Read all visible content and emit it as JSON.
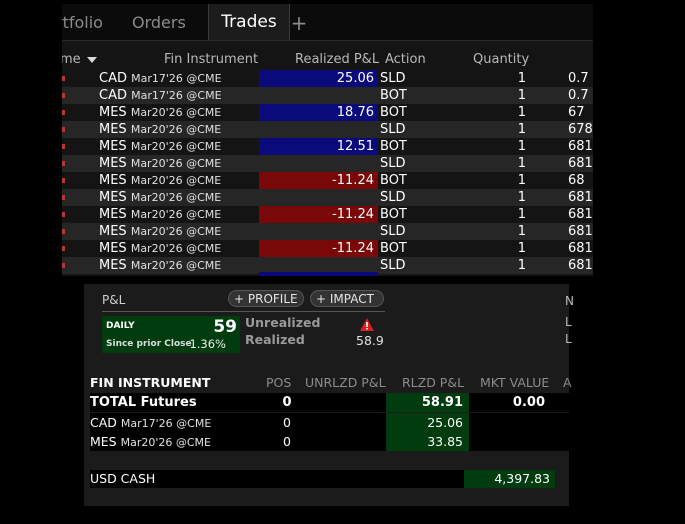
{
  "tabs": {
    "portfolio": "rtfolio",
    "orders": "Orders",
    "trades": "Trades",
    "add": "+"
  },
  "trades_table": {
    "headers": {
      "time": "me",
      "fin_instrument": "Fin Instrument",
      "realized_pnl": "Realized P&L",
      "action": "Action",
      "quantity": "Quantity"
    },
    "rows": [
      {
        "sym": "CAD",
        "exp": "Mar17'26 @CME",
        "rpl": "25.06",
        "sign": "pos",
        "action": "SLD",
        "qty": "1",
        "price": "0.7"
      },
      {
        "sym": "CAD",
        "exp": "Mar17'26 @CME",
        "rpl": "",
        "sign": "",
        "action": "BOT",
        "qty": "1",
        "price": "0.7"
      },
      {
        "sym": "MES",
        "exp": "Mar20'26 @CME",
        "rpl": "18.76",
        "sign": "pos",
        "action": "BOT",
        "qty": "1",
        "price": "67"
      },
      {
        "sym": "MES",
        "exp": "Mar20'26 @CME",
        "rpl": "",
        "sign": "",
        "action": "SLD",
        "qty": "1",
        "price": "678"
      },
      {
        "sym": "MES",
        "exp": "Mar20'26 @CME",
        "rpl": "12.51",
        "sign": "pos",
        "action": "BOT",
        "qty": "1",
        "price": "681"
      },
      {
        "sym": "MES",
        "exp": "Mar20'26 @CME",
        "rpl": "",
        "sign": "",
        "action": "SLD",
        "qty": "1",
        "price": "681"
      },
      {
        "sym": "MES",
        "exp": "Mar20'26 @CME",
        "rpl": "-11.24",
        "sign": "neg",
        "action": "BOT",
        "qty": "1",
        "price": "68"
      },
      {
        "sym": "MES",
        "exp": "Mar20'26 @CME",
        "rpl": "",
        "sign": "",
        "action": "SLD",
        "qty": "1",
        "price": "681"
      },
      {
        "sym": "MES",
        "exp": "Mar20'26 @CME",
        "rpl": "-11.24",
        "sign": "neg",
        "action": "BOT",
        "qty": "1",
        "price": "681"
      },
      {
        "sym": "MES",
        "exp": "Mar20'26 @CME",
        "rpl": "",
        "sign": "",
        "action": "SLD",
        "qty": "1",
        "price": "681"
      },
      {
        "sym": "MES",
        "exp": "Mar20'26 @CME",
        "rpl": "-11.24",
        "sign": "neg",
        "action": "BOT",
        "qty": "1",
        "price": "681"
      },
      {
        "sym": "MES",
        "exp": "Mar20'26 @CME",
        "rpl": "",
        "sign": "",
        "action": "SLD",
        "qty": "1",
        "price": "681"
      }
    ]
  },
  "pnl": {
    "label": "P&L",
    "profile_btn": "+ PROFILE",
    "impact_btn": "+ IMPACT",
    "daily_label": "DAILY",
    "daily_value": "59",
    "since_label": "Since prior Close",
    "since_value": "1.36%",
    "unrealized_label": "Unrealized",
    "realized_label": "Realized",
    "realized_value": "58.9",
    "edge_n": "N",
    "edge_l1": "L",
    "edge_l2": "L"
  },
  "portfolio_table": {
    "headers": {
      "fin": "FIN INSTRUMENT",
      "pos": "POS",
      "unrlzd": "UNRLZD P&L",
      "rlzd": "RLZD P&L",
      "mkt": "MKT VALUE",
      "extra": "A"
    },
    "total": {
      "label": "TOTAL Futures",
      "pos": "0",
      "rlzd": "58.91",
      "mkt": "0.00"
    },
    "rows": [
      {
        "sym": "CAD",
        "exp": "Mar17'26 @CME",
        "pos": "0",
        "rlzd": "25.06"
      },
      {
        "sym": "MES",
        "exp": "Mar20'26 @CME",
        "pos": "0",
        "rlzd": "33.85"
      }
    ],
    "cash": {
      "label": "USD CASH",
      "value": "4,397.83"
    }
  },
  "colors": {
    "positive_bg": "#0a0a7a",
    "negative_bg": "#7a0808",
    "gain_bg": "#003c0e",
    "warning": "#d42020"
  }
}
